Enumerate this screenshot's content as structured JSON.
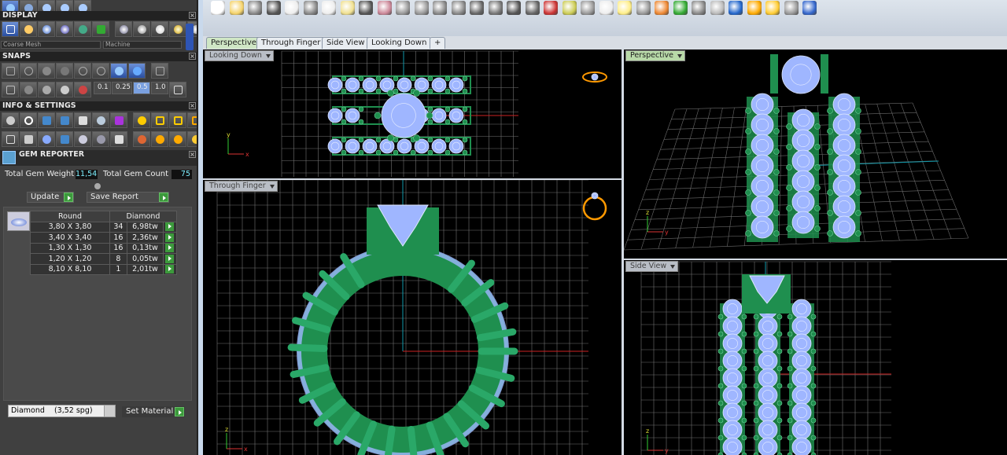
{
  "panels": {
    "display": "DISPLAY",
    "snaps": "SNAPS",
    "info": "INFO & SETTINGS",
    "gem_reporter": "GEM REPORTER"
  },
  "display": {
    "mesh_select": "Coarse Mesh",
    "machine_select": "Machine"
  },
  "snaps": {
    "values": [
      "0.1",
      "0.25",
      "0.5",
      "1.0"
    ]
  },
  "gem": {
    "total_weight_label": "Total Gem Weight",
    "total_weight": "11,54",
    "total_count_label": "Total Gem Count",
    "total_count": "75",
    "update": "Update",
    "save_report": "Save Report",
    "headers": [
      "Round",
      "Diamond"
    ],
    "rows": [
      {
        "size": "3,80 X 3,80",
        "count": "34",
        "weight": "6,98tw"
      },
      {
        "size": "3,40 X 3,40",
        "count": "16",
        "weight": "2,36tw"
      },
      {
        "size": "1,30 X 1,30",
        "count": "16",
        "weight": "0,13tw"
      },
      {
        "size": "1,20 X 1,20",
        "count": "8",
        "weight": "0,05tw"
      },
      {
        "size": "8,10 X 8,10",
        "count": "1",
        "weight": "2,01tw"
      }
    ],
    "material": "Diamond    (3,52 spg)",
    "set_material": "Set Material"
  },
  "tabs": [
    "Perspective",
    "Through Finger",
    "Side View",
    "Looking Down"
  ],
  "viewports": {
    "looking_down": "Looking Down",
    "perspective": "Perspective",
    "through_finger": "Through Finger",
    "side_view": "Side View"
  },
  "colors": {
    "gem": "#9fb6ff",
    "metal": "#1f8f4f",
    "grid": "#9a9a9a"
  }
}
